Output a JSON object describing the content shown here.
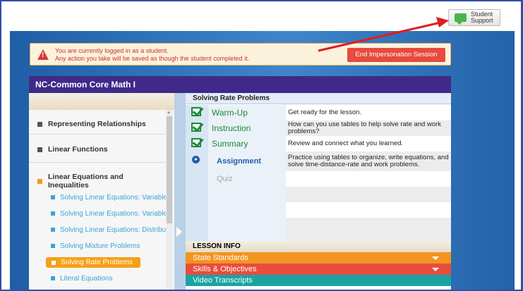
{
  "support": {
    "label": "Student\nSupport"
  },
  "alert": {
    "message": "You are currently logged in as a student.\nAny action you take will be saved as though the student completed it.",
    "end_button": "End Impersonation Session"
  },
  "course": {
    "title": "NC-Common Core Math I"
  },
  "sidebar": {
    "sections": [
      {
        "label": "Representing Relationships"
      },
      {
        "label": "Linear Functions"
      },
      {
        "label": "Linear Equations and Inequalities"
      }
    ],
    "sub_items": [
      {
        "label": "Solving Linear Equations: Variable"
      },
      {
        "label": "Solving Linear Equations: Variable"
      },
      {
        "label": "Solving Linear Equations: Distribu"
      },
      {
        "label": "Solving Mixture Problems"
      },
      {
        "label": "Solving Rate Problems"
      },
      {
        "label": "Literal Equations"
      }
    ]
  },
  "lesson": {
    "title": "Solving Rate Problems",
    "rows": [
      {
        "name": "Warm-Up",
        "desc": "Get ready for the lesson.",
        "status": "complete"
      },
      {
        "name": "Instruction",
        "desc": "How can you use tables to help solve rate and work problems?",
        "status": "complete"
      },
      {
        "name": "Summary",
        "desc": "Review and connect what you learned.",
        "status": "complete"
      },
      {
        "name": "Assignment",
        "desc": "Practice using tables to organize, write equations, and solve time-distance-rate and work problems.",
        "status": "current"
      },
      {
        "name": "Quiz",
        "desc": "",
        "status": "locked"
      }
    ]
  },
  "lesson_info": {
    "header": "LESSON INFO",
    "bars": [
      {
        "label": "State Standards",
        "color": "#f2941f"
      },
      {
        "label": "Skills & Objectives",
        "color": "#e84c3d"
      },
      {
        "label": "Video Transcripts",
        "color": "#1aa3a3"
      }
    ]
  },
  "colors": {
    "accent": "#3f2a8a",
    "brand_blue": "#1f5ea6",
    "success": "#1b8a3c",
    "warning": "#e64b3c"
  }
}
